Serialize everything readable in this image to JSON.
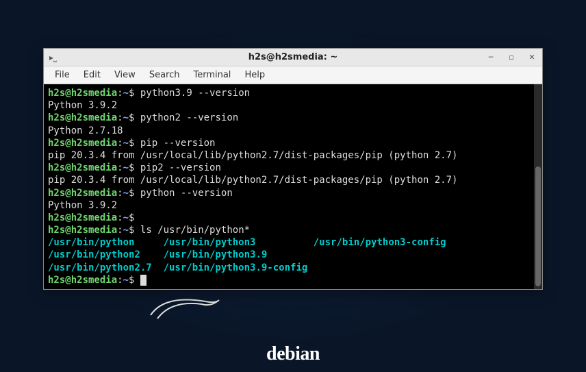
{
  "window": {
    "title": "h2s@h2smedia: ~"
  },
  "menubar": {
    "file": "File",
    "edit": "Edit",
    "view": "View",
    "search": "Search",
    "terminal": "Terminal",
    "help": "Help"
  },
  "prompt": {
    "user_host": "h2s@h2smedia",
    "sep": ":",
    "path": "~",
    "symbol": "$"
  },
  "lines": {
    "cmd1": "python3.9 --version",
    "out1": "Python 3.9.2",
    "cmd2": "python2 --version",
    "out2": "Python 2.7.18",
    "cmd3": "pip --version",
    "out3": "pip 20.3.4 from /usr/local/lib/python2.7/dist-packages/pip (python 2.7)",
    "cmd4": "pip2 --version",
    "out4": "pip 20.3.4 from /usr/local/lib/python2.7/dist-packages/pip (python 2.7)",
    "cmd5": "python --version",
    "out5": "Python 3.9.2",
    "cmd6": "",
    "cmd7": "ls /usr/bin/python*",
    "ls1a": "/usr/bin/python",
    "ls1b": "/usr/bin/python3",
    "ls1c": "/usr/bin/python3-config",
    "ls2a": "/usr/bin/python2",
    "ls2b": "/usr/bin/python3.9",
    "ls3a": "/usr/bin/python2.7",
    "ls3b": "/usr/bin/python3.9-config"
  },
  "spaces": {
    "gap1a": "     ",
    "gap1b": "          ",
    "gap2a": "    ",
    "gap3a": "  "
  },
  "desktop": {
    "debian": "debian"
  }
}
